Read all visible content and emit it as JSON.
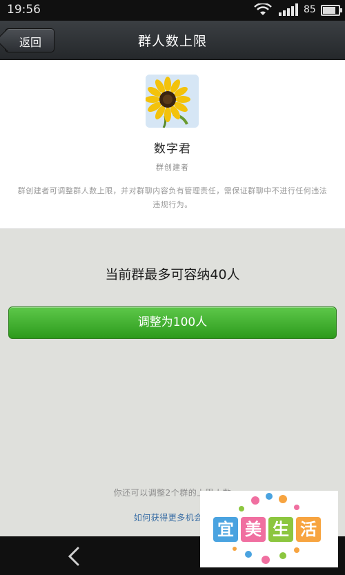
{
  "status_bar": {
    "time": "19:56",
    "battery_level": "85",
    "wifi_icon": "wifi-icon",
    "signal_icon": "signal-icon",
    "battery_icon": "battery-icon"
  },
  "header": {
    "back_label": "返回",
    "title": "群人数上限"
  },
  "creator": {
    "avatar_icon": "sunflower-avatar",
    "name": "数字君",
    "role": "群创建者",
    "description": "群创建者可调整群人数上限，并对群聊内容负有管理责任，需保证群聊中不进行任何违法违规行为。"
  },
  "capacity": {
    "current_text": "当前群最多可容纳40人",
    "upgrade_button_label": "调整为100人"
  },
  "footer": {
    "remaining_note": "你还可以调整2个群的上限人数",
    "more_link": "如何获得更多机会？"
  },
  "watermark": {
    "chars": [
      "宜",
      "美",
      "生",
      "活"
    ],
    "colors": [
      "#4aa3e0",
      "#f06fa0",
      "#8cc63f",
      "#f7a440"
    ]
  },
  "colors": {
    "accent_green": "#2d9a1c",
    "link_blue": "#3a6ea5",
    "background": "#dfe0dc"
  }
}
